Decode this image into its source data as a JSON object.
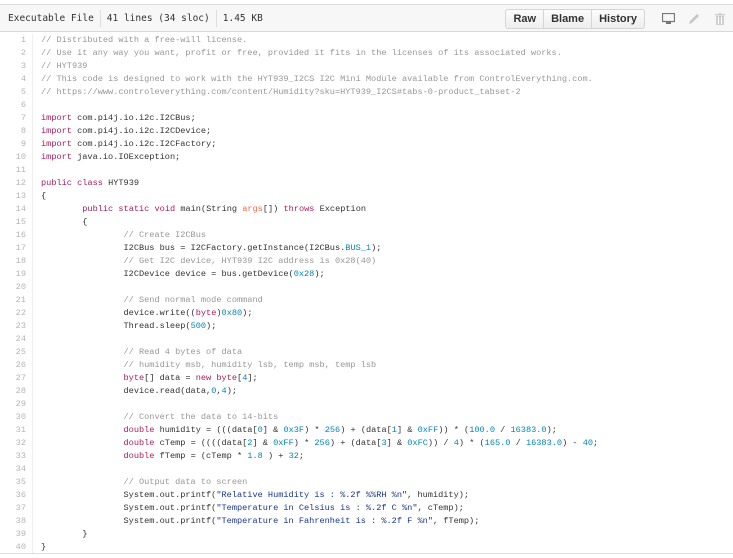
{
  "file_header": {
    "mode": "Executable File",
    "lines": "41 lines (34 sloc)",
    "size": "1.45 KB",
    "buttons": {
      "raw": "Raw",
      "blame": "Blame",
      "history": "History"
    },
    "icons": [
      "desktop-icon",
      "pencil-icon",
      "trash-icon"
    ]
  },
  "code": {
    "language": "java",
    "lines": [
      "// Distributed with a free-will license.",
      "// Use it any way you want, profit or free, provided it fits in the licenses of its associated works.",
      "// HYT939",
      "// This code is designed to work with the HYT939_I2CS I2C Mini Module available from ControlEverything.com.",
      "// https://www.controleverything.com/content/Humidity?sku=HYT939_I2CS#tabs-0-product_tabset-2",
      "",
      "import com.pi4j.io.i2c.I2CBus;",
      "import com.pi4j.io.i2c.I2CDevice;",
      "import com.pi4j.io.i2c.I2CFactory;",
      "import java.io.IOException;",
      "",
      "public class HYT939",
      "{",
      "\tpublic static void main(String args[]) throws Exception",
      "\t{",
      "\t\t// Create I2CBus",
      "\t\tI2CBus bus = I2CFactory.getInstance(I2CBus.BUS_1);",
      "\t\t// Get I2C device, HYT939 I2C address is 0x28(40)",
      "\t\tI2CDevice device = bus.getDevice(0x28);",
      "",
      "\t\t// Send normal mode command",
      "\t\tdevice.write((byte)0x80);",
      "\t\tThread.sleep(500);",
      "",
      "\t\t// Read 4 bytes of data",
      "\t\t// humidity msb, humidity lsb, temp msb, temp lsb",
      "\t\tbyte[] data = new byte[4];",
      "\t\tdevice.read(data,0,4);",
      "",
      "\t\t// Convert the data to 14-bits",
      "\t\tdouble humidity = (((data[0] & 0x3F) * 256) + (data[1] & 0xFF)) * (100.0 / 16383.0);",
      "\t\tdouble cTemp = ((((data[2] & 0xFF) * 256) + (data[3] & 0xFC)) / 4) * (165.0 / 16383.0) - 40;",
      "\t\tdouble fTemp = (cTemp * 1.8 ) + 32;",
      "",
      "\t\t// Output data to screen",
      "\t\tSystem.out.printf(\"Relative Humidity is : %.2f %%RH %n\", humidity);",
      "\t\tSystem.out.printf(\"Temperature in Celsius is : %.2f C %n\", cTemp);",
      "\t\tSystem.out.printf(\"Temperature in Fahrenheit is : %.2f F %n\", fTemp);",
      "\t}",
      "}"
    ]
  }
}
